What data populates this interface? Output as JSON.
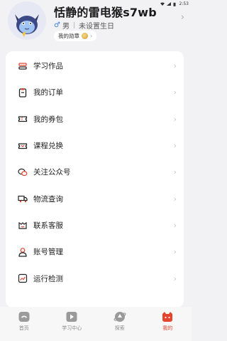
{
  "status_bar": {
    "time": "2:53"
  },
  "profile": {
    "username": "恬静的雷电猴s7wb",
    "gender": "男",
    "birthday": "未设置生日",
    "badge_label": "我的勋章"
  },
  "menu": {
    "items": [
      {
        "label": "学习作品",
        "icon": "works-icon"
      },
      {
        "label": "我的订单",
        "icon": "order-icon"
      },
      {
        "label": "我的券包",
        "icon": "coupon-icon"
      },
      {
        "label": "课程兑换",
        "icon": "exchange-icon"
      },
      {
        "label": "关注公众号",
        "icon": "wechat-icon"
      },
      {
        "label": "物流查询",
        "icon": "truck-icon"
      },
      {
        "label": "联系客服",
        "icon": "service-icon"
      },
      {
        "label": "账号管理",
        "icon": "account-icon"
      },
      {
        "label": "运行检测",
        "icon": "chart-icon"
      }
    ]
  },
  "tabs": [
    {
      "label": "首页",
      "icon": "home-icon",
      "active": false
    },
    {
      "label": "学习中心",
      "icon": "play-icon",
      "active": false
    },
    {
      "label": "探索",
      "icon": "explore-icon",
      "active": false
    },
    {
      "label": "我的",
      "icon": "mine-icon",
      "active": true
    }
  ],
  "colors": {
    "accent": "#e3442d",
    "gender": "#3b82f6"
  }
}
